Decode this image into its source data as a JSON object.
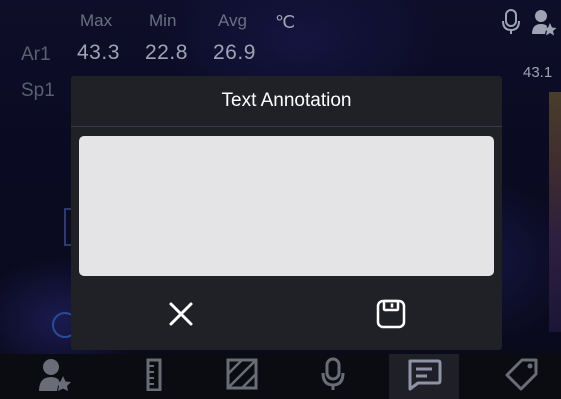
{
  "measurement": {
    "headers": {
      "max": "Max",
      "min": "Min",
      "avg": "Avg"
    },
    "unit": "℃",
    "rows": [
      {
        "label": "Ar1",
        "max": "43.3",
        "min": "22.8",
        "avg": "26.9"
      },
      {
        "label": "Sp1"
      }
    ]
  },
  "scale": {
    "max": "43.1"
  },
  "dialog": {
    "title": "Text Annotation",
    "text_value": ""
  },
  "icons": {
    "top_right": [
      "microphone-icon",
      "user-star-icon"
    ],
    "dialog": [
      "close-icon",
      "save-icon"
    ],
    "toolbar": [
      "user-star-icon",
      "thermometer-icon",
      "area-hatch-icon",
      "microphone-icon",
      "comment-icon",
      "tag-icon"
    ]
  },
  "toolbar": {
    "active": "comment"
  },
  "colors": {
    "dialog_bg": "#202127",
    "text_area_bg": "#e4e4e6",
    "icon": "#ffffff",
    "dim_icon": "#6a6c78"
  }
}
